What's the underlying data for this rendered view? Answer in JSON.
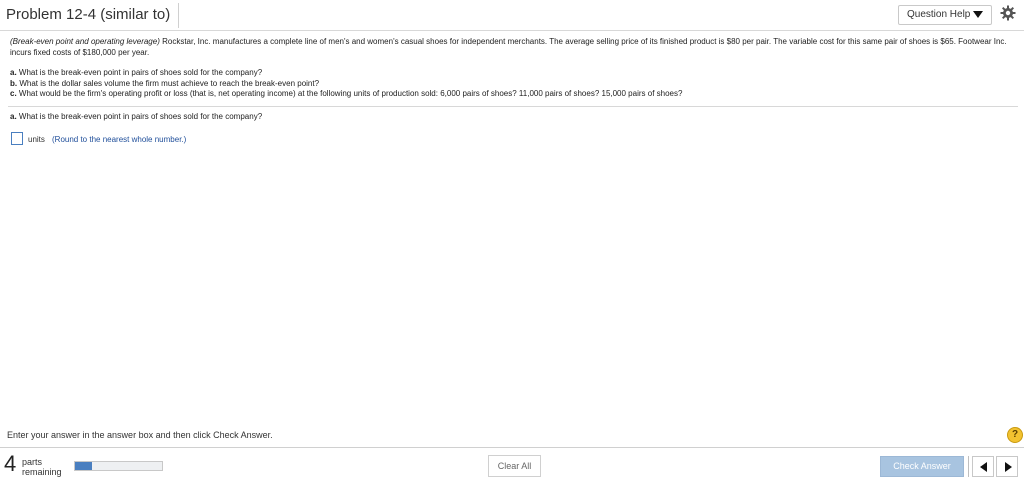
{
  "header": {
    "title": "Problem 12-4 (similar to)",
    "question_help": "Question Help",
    "settings_icon": "gear-icon"
  },
  "problem": {
    "intro_italic": "(Break-even point and operating leverage)",
    "intro_text": " Rockstar, Inc. manufactures a complete line of men's and women's casual shoes for independent merchants. The average selling price of its finished product is $80 per pair. The variable cost for this same pair of shoes is $65. Footwear Inc. incurs fixed costs of $180,000 per year."
  },
  "questions": [
    {
      "letter": "a.",
      "text": " What is the break-even point in pairs of shoes sold for the company?"
    },
    {
      "letter": "b.",
      "text": " What is the dollar sales volume the firm must achieve to reach the break-even point?"
    },
    {
      "letter": "c.",
      "text": " What would be the firm's operating profit or loss (that is, net operating income) at the following units of production sold: 6,000 pairs of shoes? 11,000 pairs of shoes? 15,000 pairs of shoes?"
    }
  ],
  "current_part": {
    "letter": "a.",
    "text": " What is the break-even point in pairs of shoes sold for the company?"
  },
  "answer": {
    "value": "",
    "units_label": "units",
    "round_note": "(Round to the nearest whole number.)"
  },
  "instructions": "Enter your answer in the answer box and then click Check Answer.",
  "footer": {
    "parts_count": "4",
    "parts_word": "parts",
    "remaining_word": "remaining",
    "progress_fraction": 0.2,
    "clear_all": "Clear All",
    "check_answer": "Check Answer",
    "prev_icon": "triangle-left-icon",
    "next_icon": "triangle-right-icon"
  },
  "colors": {
    "accent": "#4a7fc0",
    "check_button": "#a8c4e0",
    "help_badge": "#f2c230",
    "link_text": "#1f4e9a"
  }
}
